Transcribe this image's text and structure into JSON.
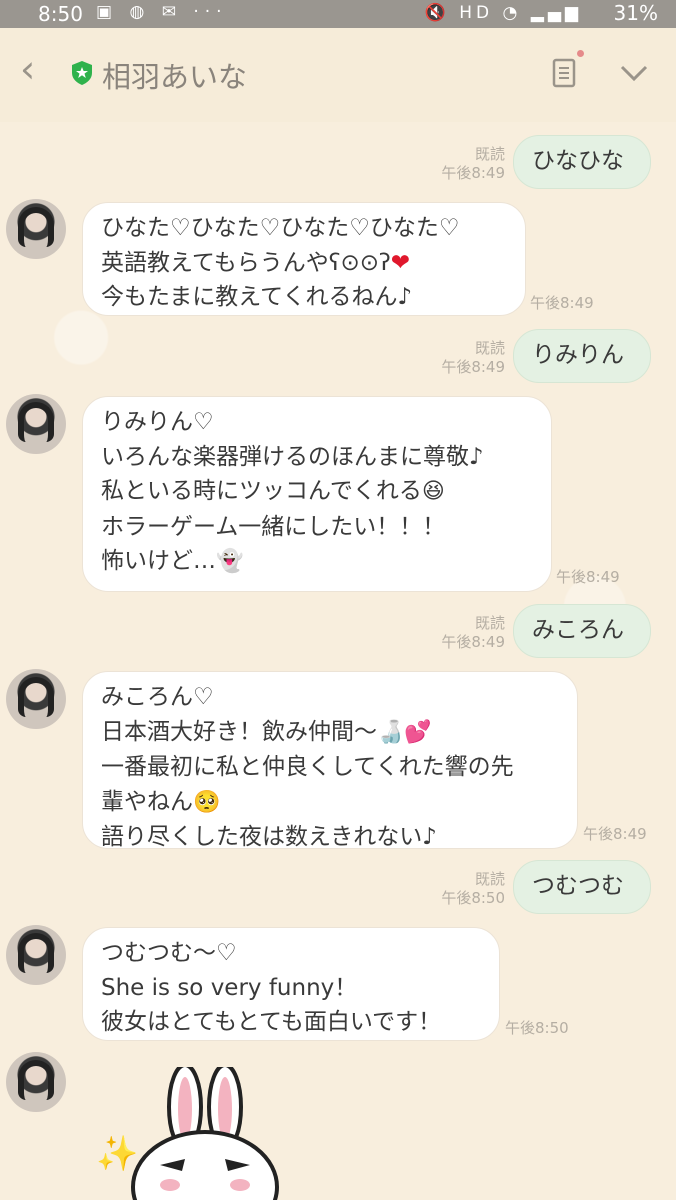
{
  "status": {
    "time": "8:50",
    "battery": "31%",
    "left_icons": "▣ ◍ ✉ ···",
    "right_icons": "🔇 HD ◔ ▂▄▆"
  },
  "header": {
    "back_icon": "‹",
    "title": "相羽あいな"
  },
  "messages": [
    {
      "side": "right",
      "text": "ひなひな",
      "read": "既読",
      "time": "午後8:49"
    },
    {
      "side": "left",
      "lines": [
        "ひなた♡ひなた♡ひなた♡ひなた♡",
        "英語教えてもらうんや",
        "今もたまに教えてくれるねん♪"
      ],
      "time": "午後8:49"
    },
    {
      "side": "right",
      "text": "りみりん",
      "read": "既読",
      "time": "午後8:49"
    },
    {
      "side": "left",
      "lines": [
        "りみりん♡",
        "いろんな楽器弾けるのほんまに尊敬♪",
        "私といる時にツッコんでくれる",
        "ホラーゲーム一緒にしたい！！！",
        "怖いけど…"
      ],
      "time": "午後8:49"
    },
    {
      "side": "right",
      "text": "みころん",
      "read": "既読",
      "time": "午後8:49"
    },
    {
      "side": "left",
      "lines": [
        "みころん♡",
        "日本酒大好き！飲み仲間〜",
        "一番最初に私と仲良くしてくれた響の先",
        "輩やねん",
        "語り尽くした夜は数えきれない♪"
      ],
      "time": "午後8:49"
    },
    {
      "side": "right",
      "text": "つむつむ",
      "read": "既読",
      "time": "午後8:50"
    },
    {
      "side": "left",
      "lines": [
        "つむつむ〜♡",
        "She is so very funny！",
        "彼女はとてもとても面白いです！"
      ],
      "time": "午後8:50"
    }
  ],
  "emoji": {
    "face_wink": "ʕ⊙⊙ʔ",
    "heart": "❤",
    "grin": "😆",
    "ghost": "👻",
    "sake": "🍶",
    "hearts": "💕",
    "pleading": "🥺",
    "sparkle": "✨"
  }
}
